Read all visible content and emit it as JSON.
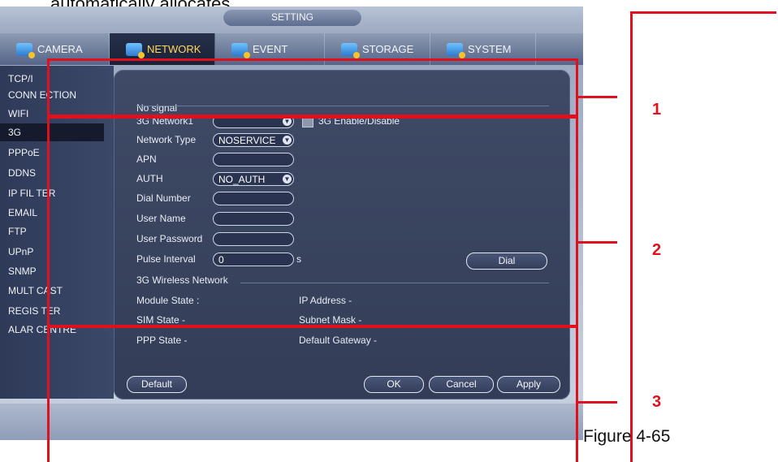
{
  "document": {
    "top_text": "automatically allocates.",
    "figure_caption": "Figure 4-65"
  },
  "window": {
    "title": "SETTING"
  },
  "tabs": [
    {
      "label": "CAMERA",
      "icon": "camera-icon"
    },
    {
      "label": "NETWORK",
      "icon": "network-icon"
    },
    {
      "label": "EVENT",
      "icon": "event-icon"
    },
    {
      "label": "STORAGE",
      "icon": "storage-icon"
    },
    {
      "label": "SYSTEM",
      "icon": "system-icon"
    }
  ],
  "sidebar": {
    "items": [
      "TCP/I",
      "CONN ECTION",
      "WIFI",
      "3G",
      "PPPoE",
      "DDNS",
      "IP FIL TER",
      "EMAIL",
      "FTP",
      "UPnP",
      "SNMP",
      "MULT CAST",
      "REGIS TER",
      "ALAR CENTRE"
    ],
    "active": "3G"
  },
  "signal": {
    "status": "No signal"
  },
  "form": {
    "network_label": "3G Network1",
    "enable_label": "3G Enable/Disable",
    "network_type_label": "Network Type",
    "network_type_value": "NOSERVICE",
    "apn_label": "APN",
    "auth_label": "AUTH",
    "auth_value": "NO_AUTH",
    "dial_number_label": "Dial Number",
    "user_name_label": "User Name",
    "user_password_label": "User Password",
    "pulse_interval_label": "Pulse Interval",
    "pulse_interval_value": "0",
    "pulse_interval_unit": "s",
    "dial_button": "Dial"
  },
  "wireless": {
    "section_title": "3G Wireless Network",
    "module_state": "Module State :",
    "sim_state": "SIM State -",
    "ppp_state": "PPP State -",
    "ip_address": "IP Address -",
    "subnet_mask": "Subnet Mask -",
    "default_gateway": "Default Gateway -"
  },
  "buttons": {
    "default": "Default",
    "ok": "OK",
    "cancel": "Cancel",
    "apply": "Apply"
  },
  "annotations": {
    "one": "1",
    "two": "2",
    "three": "3"
  },
  "colors": {
    "annotation_red": "#e0101c",
    "active_tab_text": "#ffd85a"
  }
}
